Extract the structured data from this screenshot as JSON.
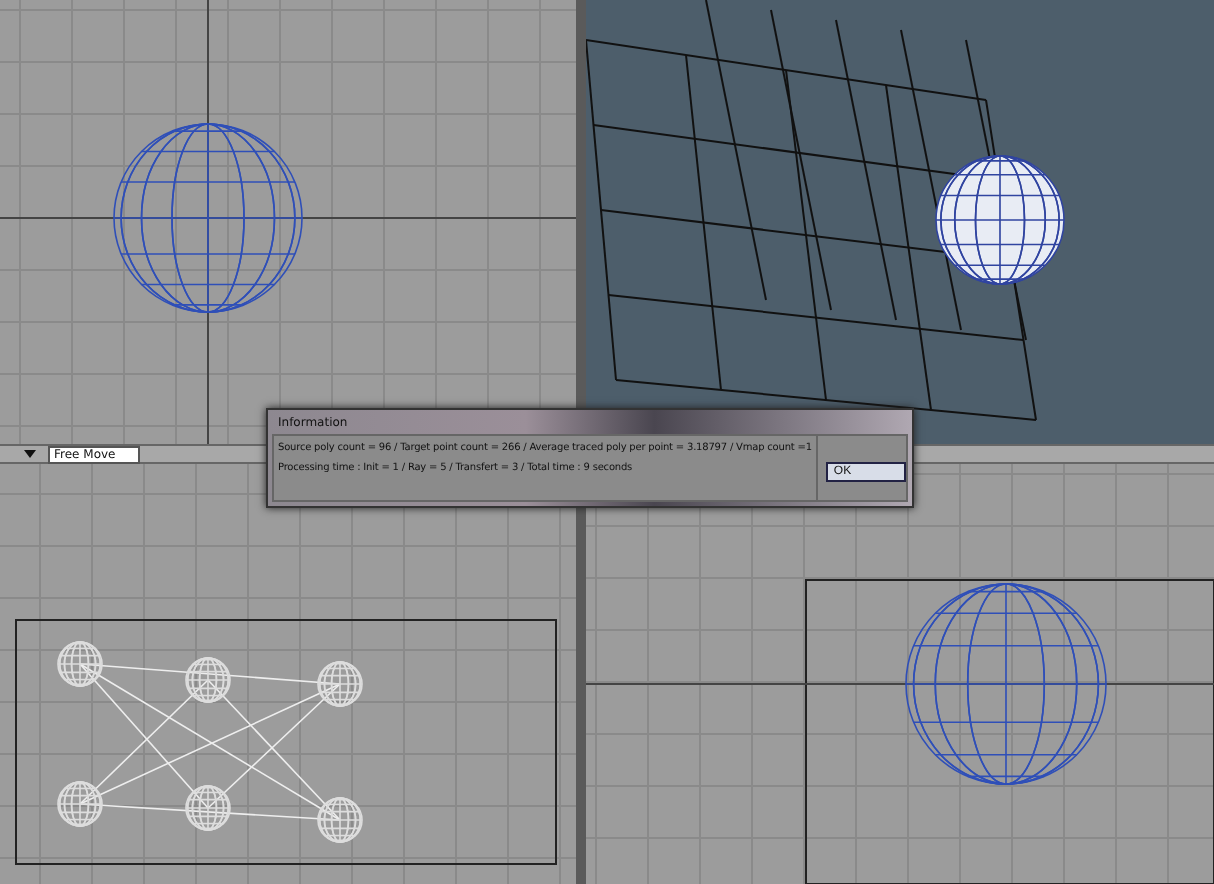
{
  "toolbar": {
    "mode_dropdown": {
      "value": "Free Move"
    }
  },
  "dialog": {
    "title": "Information",
    "lines": [
      "Source poly count = 96 / Target point count = 266 / Average traced poly per point = 3.18797 / Vmap count =1",
      "Processing time : Init = 1 / Ray = 5 / Transfert = 3 / Total time : 9 seconds"
    ],
    "buttons": [
      {
        "label": "OK",
        "selected": true
      }
    ]
  }
}
